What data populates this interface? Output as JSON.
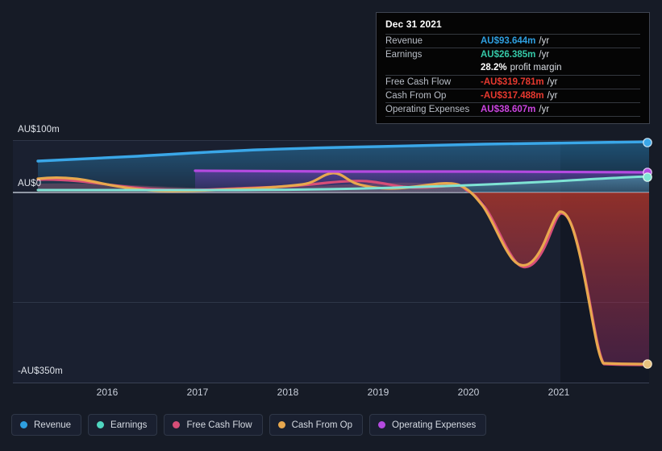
{
  "chart_data": {
    "type": "area",
    "title": "",
    "xlabel": "",
    "ylabel": "",
    "currency": "AU$",
    "grid": true,
    "legend_position": "bottom",
    "ylim": [
      -350,
      100
    ],
    "y_ticks": [
      {
        "label": "AU$100m",
        "value": 100
      },
      {
        "label": "AU$0",
        "value": 0
      },
      {
        "label": "-AU$350m",
        "value": -350
      }
    ],
    "x_ticks": [
      "2016",
      "2017",
      "2018",
      "2019",
      "2020",
      "2021"
    ],
    "x_range": [
      "2015.3",
      "2022.1"
    ],
    "series": [
      {
        "name": "Revenue",
        "color": "#2e9fe0",
        "x": [
          2015.45,
          2016.0,
          2016.5,
          2017.0,
          2017.5,
          2018.0,
          2018.5,
          2019.0,
          2019.5,
          2020.0,
          2020.5,
          2021.0,
          2021.5,
          2022.0
        ],
        "values": [
          62,
          60,
          58,
          57,
          58,
          60,
          62,
          65,
          68,
          71,
          76,
          82,
          88,
          93.644
        ]
      },
      {
        "name": "Earnings",
        "color": "#4fd6c0",
        "x": [
          2015.45,
          2016.0,
          2016.5,
          2017.0,
          2017.5,
          2018.0,
          2018.5,
          2019.0,
          2019.5,
          2020.0,
          2020.5,
          2021.0,
          2021.5,
          2022.0
        ],
        "values": [
          2,
          2,
          2,
          2,
          2,
          3,
          4,
          6,
          9,
          12,
          16,
          20,
          24,
          26.385
        ]
      },
      {
        "name": "Free Cash Flow",
        "color": "#d64e78",
        "x": [
          2015.45,
          2016.0,
          2016.5,
          2017.0,
          2017.5,
          2018.0,
          2018.5,
          2019.0,
          2019.5,
          2020.0,
          2020.3,
          2020.55,
          2020.8,
          2021.0,
          2021.25,
          2021.5,
          2021.7,
          2022.0
        ],
        "values": [
          14,
          10,
          2,
          -3,
          -6,
          -4,
          2,
          6,
          2,
          4,
          -8,
          -140,
          -64,
          -26,
          -180,
          -316,
          -319,
          -319.781
        ]
      },
      {
        "name": "Cash From Op",
        "color": "#e8a84e",
        "x": [
          2015.45,
          2016.0,
          2016.5,
          2017.0,
          2017.5,
          2018.0,
          2018.5,
          2019.0,
          2019.5,
          2020.0,
          2020.3,
          2020.55,
          2020.8,
          2021.0,
          2021.25,
          2021.5,
          2021.7,
          2022.0
        ],
        "values": [
          16,
          12,
          4,
          -1,
          -4,
          10,
          4,
          8,
          4,
          6,
          -6,
          -138,
          -62,
          -24,
          -178,
          -314,
          -317,
          -317.488
        ]
      },
      {
        "name": "Operating Expenses",
        "color": "#b44ae0",
        "x": [
          2017.0,
          2017.5,
          2018.0,
          2018.5,
          2019.0,
          2019.5,
          2020.0,
          2020.5,
          2021.0,
          2021.5,
          2022.0
        ],
        "values": [
          28,
          29,
          30,
          31,
          32,
          33,
          34,
          35,
          36,
          37,
          38.607
        ]
      }
    ],
    "endpoints": [
      {
        "name": "Revenue",
        "color": "#2e9fe0"
      },
      {
        "name": "Operating Expenses",
        "color": "#b44ae0"
      },
      {
        "name": "Earnings",
        "color": "#4fd6c0"
      },
      {
        "name": "Cash From Op",
        "color": "#e8a84e"
      }
    ]
  },
  "tooltip": {
    "date": "Dec 31 2021",
    "rows": [
      {
        "label": "Revenue",
        "value": "AU$93.644m",
        "unit": "/yr",
        "color": "#2e9fe0"
      },
      {
        "label": "Earnings",
        "value": "AU$26.385m",
        "unit": "/yr",
        "color": "#35c9a8"
      },
      {
        "label": "",
        "value": "28.2%",
        "unit": "profit margin",
        "color": "#ffffff"
      },
      {
        "label": "Free Cash Flow",
        "value": "-AU$319.781m",
        "unit": "/yr",
        "color": "#e8392f"
      },
      {
        "label": "Cash From Op",
        "value": "-AU$317.488m",
        "unit": "/yr",
        "color": "#e8392f"
      },
      {
        "label": "Operating Expenses",
        "value": "AU$38.607m",
        "unit": "/yr",
        "color": "#cc44e0"
      }
    ]
  },
  "legend": {
    "items": [
      {
        "label": "Revenue",
        "color": "#2e9fe0"
      },
      {
        "label": "Earnings",
        "color": "#4fd6c0"
      },
      {
        "label": "Free Cash Flow",
        "color": "#d64e78"
      },
      {
        "label": "Cash From Op",
        "color": "#e8a84e"
      },
      {
        "label": "Operating Expenses",
        "color": "#b44ae0"
      }
    ]
  },
  "axis": {
    "y_top_label": "AU$100m",
    "y_zero_label": "AU$0",
    "y_bottom_label": "-AU$350m",
    "x_labels": [
      "2016",
      "2017",
      "2018",
      "2019",
      "2020",
      "2021"
    ]
  }
}
